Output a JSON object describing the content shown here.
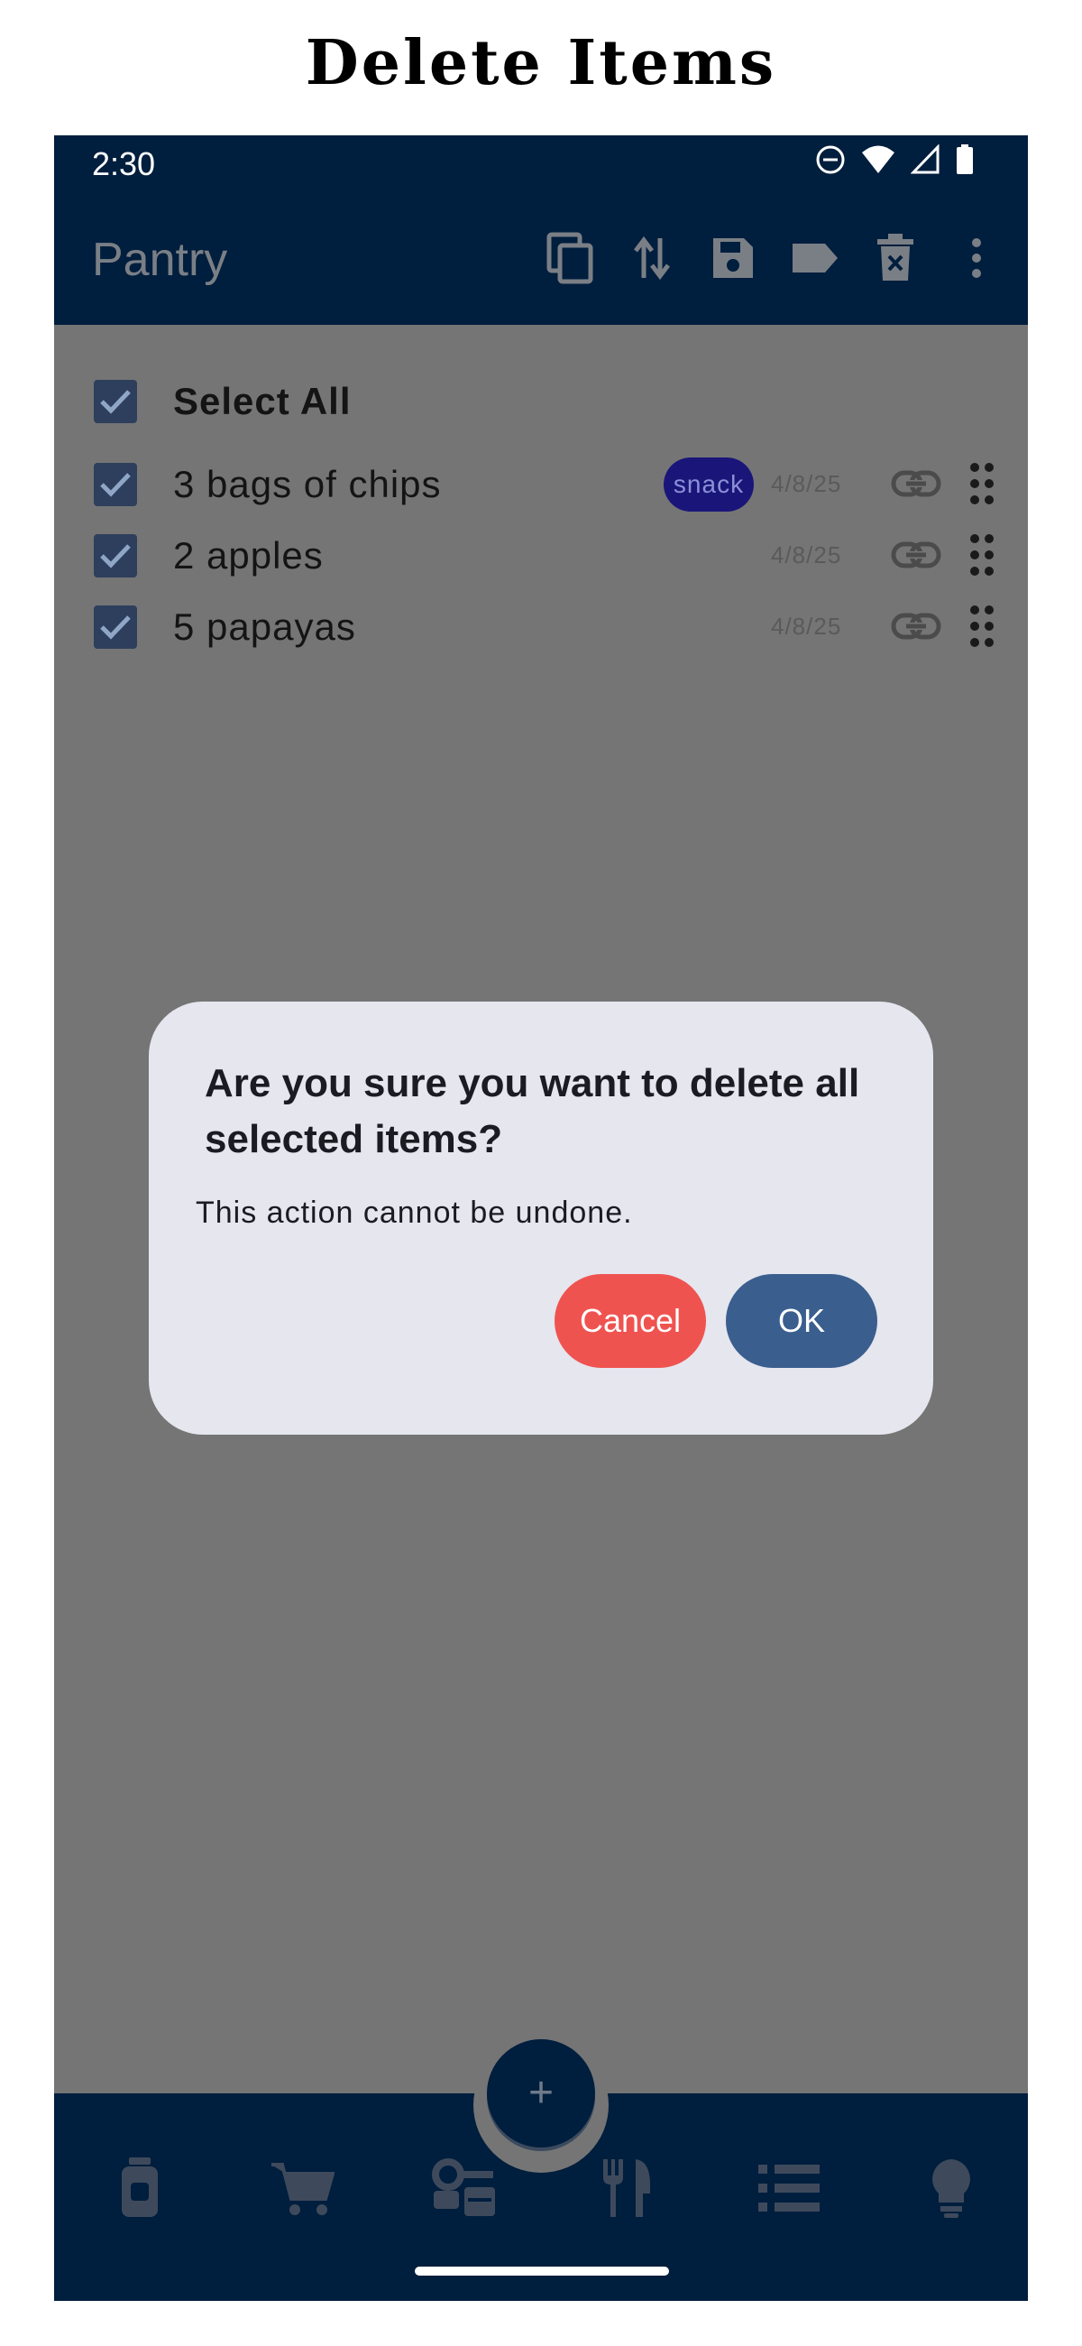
{
  "page_heading": "Delete Items",
  "status_bar": {
    "time": "2:30",
    "icons": [
      "dnd-icon",
      "wifi-icon",
      "signal-icon",
      "battery-icon"
    ]
  },
  "app_bar": {
    "title": "Pantry",
    "actions": [
      "copy-icon",
      "sort-icon",
      "save-icon",
      "label-icon",
      "delete-icon",
      "more-vert-icon"
    ]
  },
  "list": {
    "select_all_label": "Select All",
    "items": [
      {
        "text": "3 bags of chips",
        "tag": "snack",
        "date": "4/8/25",
        "checked": true
      },
      {
        "text": "2 apples",
        "tag": "",
        "date": "4/8/25",
        "checked": true
      },
      {
        "text": "5 papayas",
        "tag": "",
        "date": "4/8/25",
        "checked": true
      }
    ]
  },
  "dialog": {
    "title": "Are you sure you want to delete all selected items?",
    "body": "This action cannot be undone.",
    "cancel_label": "Cancel",
    "ok_label": "OK"
  },
  "bottom_nav": {
    "fab_label": "+",
    "items": [
      "pantry-jar-icon",
      "cart-icon",
      "kitchen-icon",
      "utensils-icon",
      "list-icon",
      "lightbulb-icon"
    ]
  },
  "colors": {
    "primary_dark": "#001E3D",
    "scrim": "#757575",
    "dialog_bg": "#E5E6EE",
    "cancel": "#EF5350",
    "ok": "#3A5E8E",
    "tag": "#1A1679"
  }
}
